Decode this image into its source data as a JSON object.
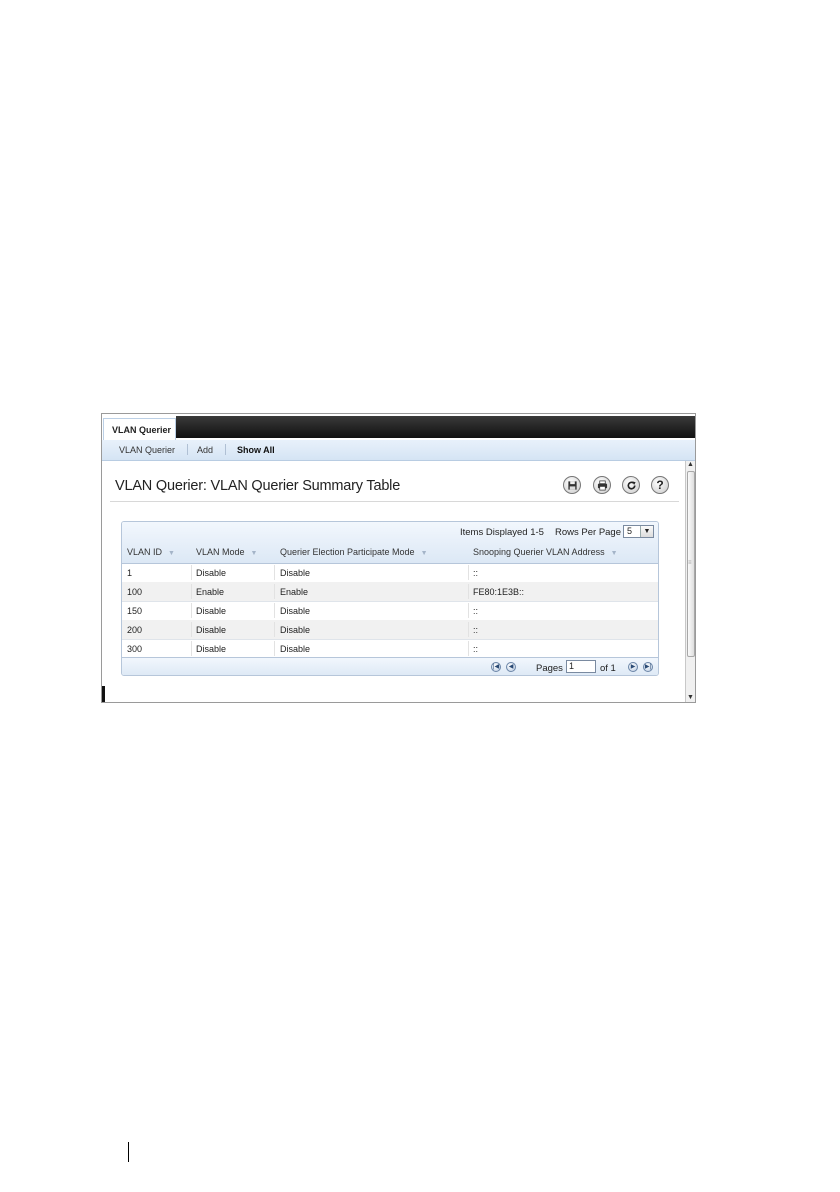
{
  "tab": {
    "label": "VLAN Querier"
  },
  "subnav": {
    "items": [
      "VLAN Querier",
      "Add",
      "Show All"
    ]
  },
  "page": {
    "title": "VLAN Querier: VLAN Querier Summary Table"
  },
  "toolbar": {
    "icons": [
      "save-icon",
      "print-icon",
      "refresh-icon",
      "help-icon"
    ],
    "help_glyph": "?"
  },
  "table": {
    "items_displayed": "Items Displayed 1-5",
    "rows_per_page_label": "Rows Per Page",
    "rows_per_page_value": "5",
    "columns": [
      "VLAN ID",
      "VLAN Mode",
      "Querier Election Participate Mode",
      "Snooping Querier VLAN Address"
    ],
    "rows": [
      [
        "1",
        "Disable",
        "Disable",
        "::"
      ],
      [
        "100",
        "Enable",
        "Enable",
        "FE80:1E3B::"
      ],
      [
        "150",
        "Disable",
        "Disable",
        "::"
      ],
      [
        "200",
        "Disable",
        "Disable",
        "::"
      ],
      [
        "300",
        "Disable",
        "Disable",
        "::"
      ]
    ],
    "pages_label": "Pages",
    "current_page": "1",
    "of_label": "of 1"
  }
}
